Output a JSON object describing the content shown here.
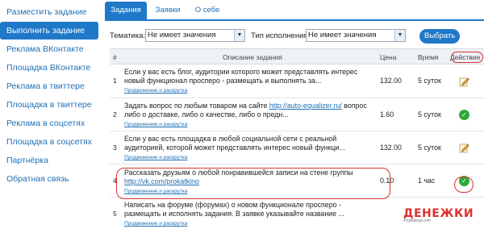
{
  "sidebar": {
    "items": [
      {
        "label": "Разместить задание",
        "active": false
      },
      {
        "label": "Выполнить задание",
        "active": true
      },
      {
        "label": "Реклама ВКонтакте",
        "active": false
      },
      {
        "label": "Площадка ВКонтакте",
        "active": false
      },
      {
        "label": "Реклама в твиттере",
        "active": false
      },
      {
        "label": "Площадка в твиттере",
        "active": false
      },
      {
        "label": "Реклама в соцсетях",
        "active": false
      },
      {
        "label": "Площадка в соцсетях",
        "active": false
      },
      {
        "label": "Партнёрка",
        "active": false
      },
      {
        "label": "Обратная связь",
        "active": false
      }
    ]
  },
  "tabs": [
    {
      "label": "Задания",
      "active": true
    },
    {
      "label": "Заявки",
      "active": false
    },
    {
      "label": "О себе",
      "active": false
    }
  ],
  "filters": {
    "topic_label": "Тематика:",
    "topic_value": "Не имеет значения",
    "type_label": "Тип исполнения:",
    "type_value": "Не имеет значения",
    "apply_label": "Выбрать"
  },
  "table": {
    "headers": {
      "num": "#",
      "desc": "Описание задания",
      "price": "Цена",
      "time": "Время",
      "action": "Действие"
    },
    "rows": [
      {
        "num": "1",
        "text": "Если у вас есть блог, аудитории которого может представлять интерес новый функционал просперо - размещать и выполнять за...",
        "link": "",
        "text_after": "",
        "category": "Продвижение и раскрутка",
        "price": "132.00",
        "time": "5 суток",
        "action": "edit"
      },
      {
        "num": "2",
        "text": "Задать вопрос по любым товаром на сайте ",
        "link": "http://auto-equalizer.ru/",
        "text_after": " вопрос либо о доставке, либо о качестве, либо о предн...",
        "category": "Продвижение и раскрутка",
        "price": "1.60",
        "time": "5 суток",
        "action": "ok"
      },
      {
        "num": "3",
        "text": "Если у вас есть площадка в любой социальной сети с реальной аудиторией, которой может представлять интерес новый функци...",
        "link": "",
        "text_after": "",
        "category": "Продвижение и раскрутка",
        "price": "132.00",
        "time": "5 суток",
        "action": "edit"
      },
      {
        "num": "4",
        "text": "Рассказать друзьям о любой понравившейся записи на стене группы ",
        "link": "http://vk.com/prokatkino",
        "text_after": "",
        "category": "Продвижение и раскрутка",
        "price": "0.10",
        "time": "1 час",
        "action": "ok"
      },
      {
        "num": "5",
        "text": "Написать на форуме (форумах) о новом функционале просперо - размещать и исполнять задания. В заявке указывайте название ...",
        "link": "",
        "text_after": "",
        "category": "Продвижение и раскрутка",
        "price": "",
        "time": "",
        "action": ""
      }
    ]
  },
  "watermark": {
    "text": "ДЕНЕЖКИ",
    "sub": "4.lubdengi.com"
  },
  "colors": {
    "accent": "#1f78c8",
    "highlight": "#d9322f",
    "ok": "#2fa83a"
  }
}
